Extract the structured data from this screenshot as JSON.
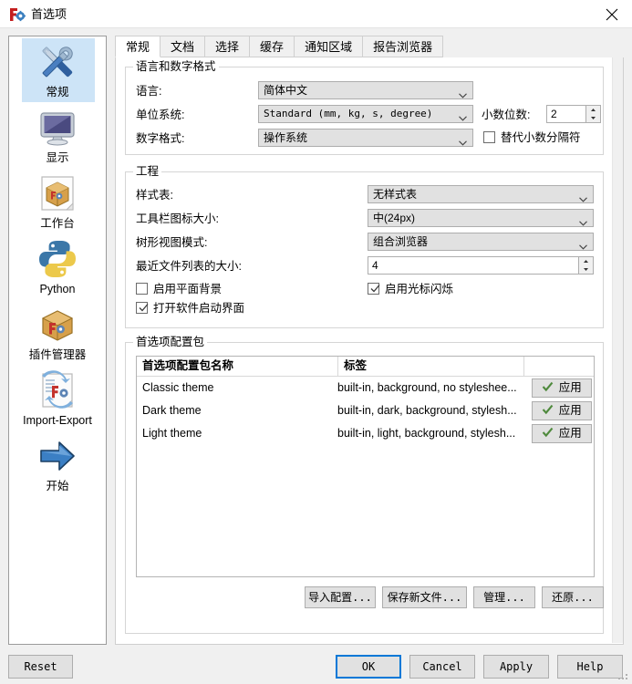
{
  "window": {
    "title": "首选项",
    "icon": "freecad-preferences-icon",
    "close_label": "✕"
  },
  "sidebar": {
    "items": [
      {
        "label": "常规",
        "icon": "tools-icon",
        "selected": true
      },
      {
        "label": "显示",
        "icon": "monitor-icon",
        "selected": false
      },
      {
        "label": "工作台",
        "icon": "workbench-box-icon",
        "selected": false
      },
      {
        "label": "Python",
        "icon": "python-icon",
        "selected": false
      },
      {
        "label": "插件管理器",
        "icon": "addon-box-icon",
        "selected": false
      },
      {
        "label": "Import-Export",
        "icon": "import-export-icon",
        "selected": false
      },
      {
        "label": "开始",
        "icon": "blue-arrow-icon",
        "selected": false
      }
    ]
  },
  "tabs": [
    {
      "label": "常规",
      "active": true
    },
    {
      "label": "文档",
      "active": false
    },
    {
      "label": "选择",
      "active": false
    },
    {
      "label": "缓存",
      "active": false
    },
    {
      "label": "通知区域",
      "active": false
    },
    {
      "label": "报告浏览器",
      "active": false
    }
  ],
  "lang_group": {
    "title": "语言和数字格式",
    "language_label": "语言:",
    "language_value": "简体中文",
    "unit_label": "单位系统:",
    "unit_value": "Standard (mm, kg, s, degree)",
    "decimals_label": "小数位数:",
    "decimals_value": "2",
    "numformat_label": "数字格式:",
    "numformat_value": "操作系统",
    "sep_checkbox_label": "替代小数分隔符",
    "sep_checkbox_checked": false
  },
  "project_group": {
    "title": "工程",
    "stylesheet_label": "样式表:",
    "stylesheet_value": "无样式表",
    "toolbar_icon_label": "工具栏图标大小:",
    "toolbar_icon_value": "中(24px)",
    "treeview_label": "树形视图模式:",
    "treeview_value": "组合浏览器",
    "recent_label": "最近文件列表的大小:",
    "recent_value": "4",
    "flat_bg_label": "启用平面背景",
    "flat_bg_checked": false,
    "cursor_blink_label": "启用光标闪烁",
    "cursor_blink_checked": true,
    "splash_label": "打开软件启动界面",
    "splash_checked": true
  },
  "packs_group": {
    "title": "首选项配置包",
    "columns": [
      "首选项配置包名称",
      "标签",
      ""
    ],
    "rows": [
      {
        "name": "Classic theme",
        "tags": "built-in, background, no styleshee...",
        "apply_label": "应用"
      },
      {
        "name": "Dark theme",
        "tags": "built-in, dark, background, stylesh...",
        "apply_label": "应用"
      },
      {
        "name": "Light theme",
        "tags": "built-in, light, background, stylesh...",
        "apply_label": "应用"
      }
    ],
    "buttons": [
      {
        "label": "导入配置..."
      },
      {
        "label": "保存新文件..."
      },
      {
        "label": "管理..."
      },
      {
        "label": "还原..."
      }
    ]
  },
  "footer": {
    "reset": "Reset",
    "ok": "OK",
    "cancel": "Cancel",
    "apply": "Apply",
    "help": "Help"
  },
  "colors": {
    "accent": "#0078d7",
    "selection": "#cde4f7",
    "control": "#e1e1e1",
    "check_green": "#4f8a3d"
  }
}
